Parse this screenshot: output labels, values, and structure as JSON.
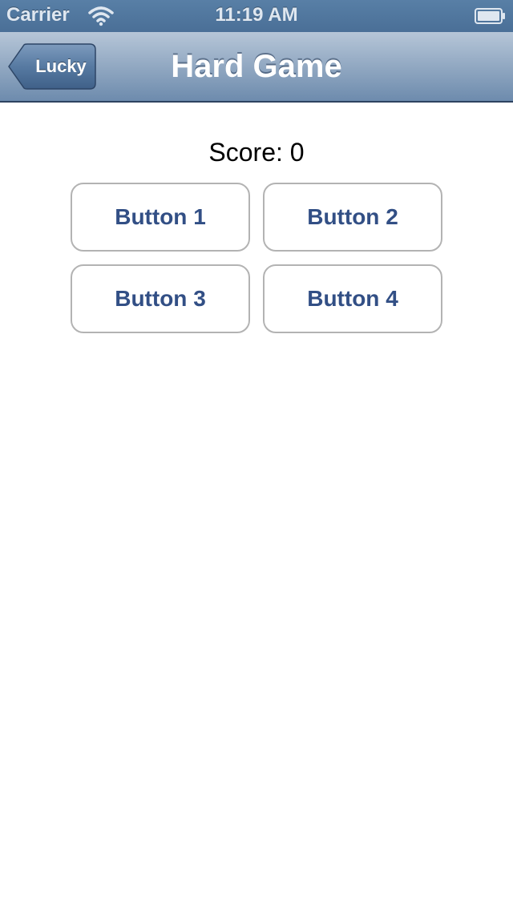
{
  "status_bar": {
    "carrier": "Carrier",
    "time": "11:19 AM",
    "wifi_icon": "wifi-icon",
    "battery_icon": "battery-icon"
  },
  "nav_bar": {
    "back_label": "Lucky",
    "title": "Hard Game"
  },
  "content": {
    "score_label": "Score: 0",
    "buttons": [
      {
        "label": "Button 1"
      },
      {
        "label": "Button 2"
      },
      {
        "label": "Button 3"
      },
      {
        "label": "Button 4"
      }
    ]
  },
  "colors": {
    "nav_bar_top": "#b6c6d8",
    "nav_bar_bottom": "#6d8bad",
    "button_text": "#324f85",
    "button_border": "#b3b3b3"
  }
}
